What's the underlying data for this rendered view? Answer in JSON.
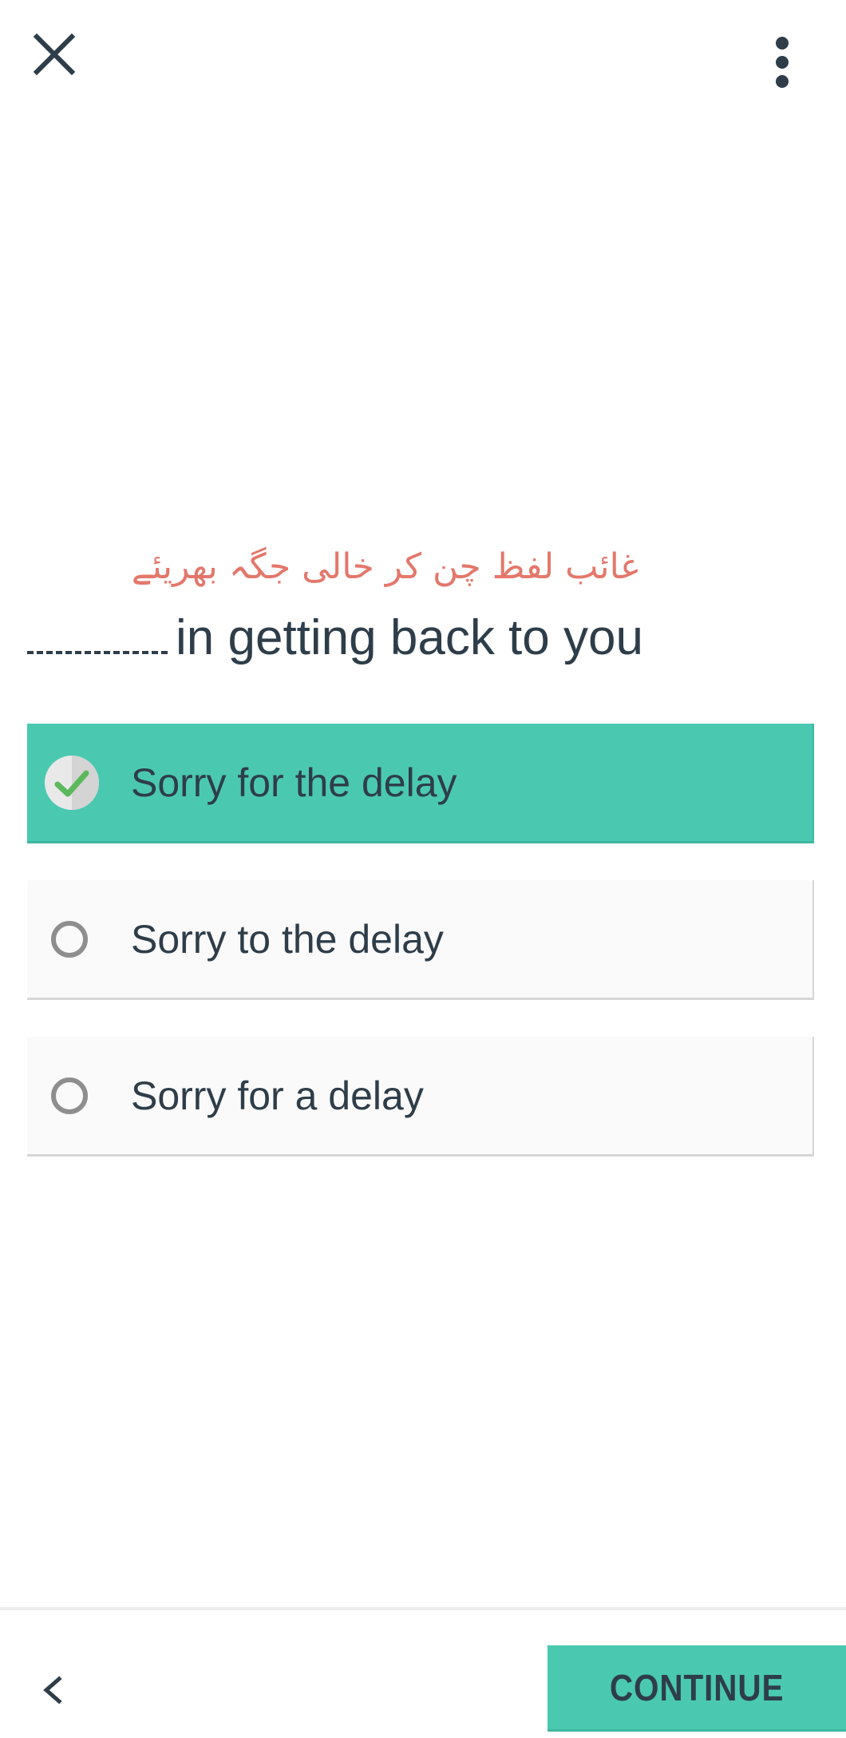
{
  "header": {
    "close_icon": "close-icon",
    "more_icon": "more-vertical-icon"
  },
  "exercise": {
    "instruction": "غائب لفظ چن کر خالی جگہ بھریئے",
    "instruction_color": "#e4776b",
    "question_text": "in getting back to you"
  },
  "options": [
    {
      "label": "Sorry for the delay",
      "selected": true
    },
    {
      "label": "Sorry to the delay",
      "selected": false
    },
    {
      "label": "Sorry for a delay",
      "selected": false
    }
  ],
  "footer": {
    "back_icon": "chevron-left-icon",
    "continue_label": "CONTINUE"
  },
  "colors": {
    "accent": "#4ac9b0",
    "text": "#2e3d49",
    "check": "#5cb85c"
  }
}
